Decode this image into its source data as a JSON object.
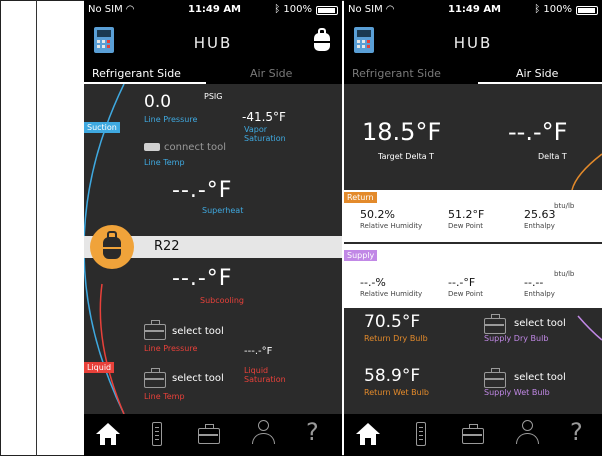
{
  "status": {
    "carrier": "No SIM",
    "time": "11:49 AM",
    "battery": "100%"
  },
  "header": {
    "title": "HUB"
  },
  "tabs": {
    "refrigerant": "Refrigerant Side",
    "air": "Air Side"
  },
  "refrigerant": {
    "suction_tag": "Suction",
    "liquid_tag": "Liquid",
    "line_pressure_value": "0.0",
    "line_pressure_unit": "PSIG",
    "line_pressure_label": "Line Pressure",
    "vapor_sat_value": "-41.5°F",
    "vapor_sat_label_1": "Vapor",
    "vapor_sat_label_2": "Saturation",
    "connect_tool": "connect tool",
    "line_temp_label": "Line Temp",
    "superheat_value": "--.-°F",
    "superheat_label": "Superheat",
    "refrigerant_name": "R22",
    "subcooling_value": "--.-°F",
    "subcooling_label": "Subcooling",
    "select_tool_1": "select tool",
    "liquid_line_pressure_label": "Line Pressure",
    "liquid_sat_value": "---.-°F",
    "liquid_sat_label_1": "Liquid",
    "liquid_sat_label_2": "Saturation",
    "select_tool_2": "select tool",
    "liquid_line_temp_label": "Line Temp"
  },
  "air": {
    "target_delta_value": "18.5°F",
    "target_delta_label": "Target Delta T",
    "delta_value": "--.-°F",
    "delta_label": "Delta T",
    "return_tag": "Return",
    "return_rh": "50.2%",
    "return_rh_label": "Relative Humidity",
    "return_dew": "51.2°F",
    "return_dew_label": "Dew Point",
    "return_enth": "25.63",
    "return_enth_unit": "btu/lb",
    "return_enth_label": "Enthalpy",
    "supply_tag": "Supply",
    "supply_rh": "--.-%",
    "supply_rh_label": "Relative Humidity",
    "supply_dew": "--.-°F",
    "supply_dew_label": "Dew Point",
    "supply_enth": "--.--",
    "supply_enth_unit": "btu/lb",
    "supply_enth_label": "Enthalpy",
    "return_dry_value": "70.5°F",
    "return_dry_label": "Return Dry Bulb",
    "select_tool_1": "select tool",
    "supply_dry_label": "Supply Dry Bulb",
    "return_wet_value": "58.9°F",
    "return_wet_label": "Return Wet Bulb",
    "select_tool_2": "select tool",
    "supply_wet_label": "Supply Wet Bulb"
  },
  "colors": {
    "suction": "#3fa9e0",
    "liquid": "#e8413a",
    "return": "#e38a2b",
    "supply": "#c188e6",
    "tank": "#f0a33a"
  }
}
